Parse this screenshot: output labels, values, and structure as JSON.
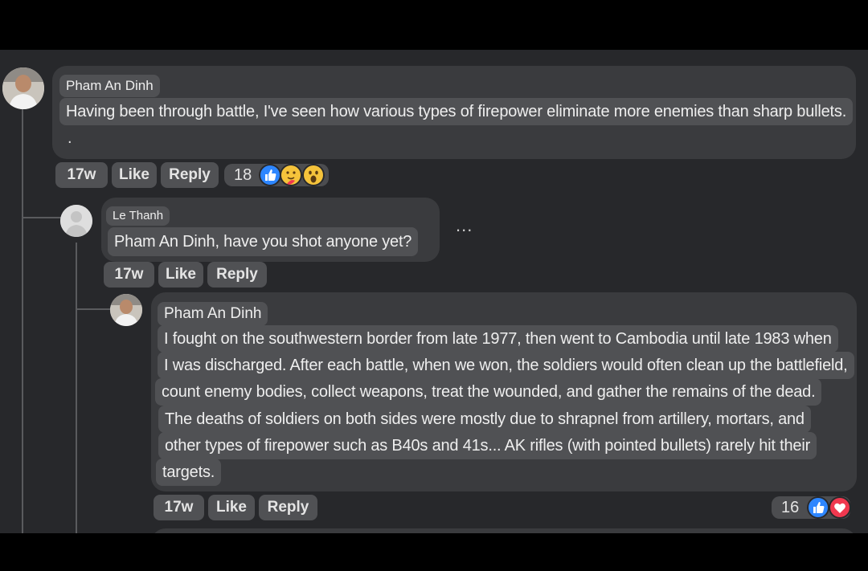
{
  "comments": [
    {
      "author": "Pham An Dinh",
      "lines": [
        "Having been through battle, I've seen how various types of firepower eliminate more enemies than sharp bullets.",
        "."
      ],
      "time": "17w",
      "like": "Like",
      "reply": "Reply",
      "reactions": "18",
      "reaction_icons": [
        "like-icon",
        "care-icon",
        "wow-icon"
      ]
    },
    {
      "author": "Le Thanh",
      "lines": [
        "Pham An Dinh, have you shot anyone yet?"
      ],
      "time": "17w",
      "like": "Like",
      "reply": "Reply",
      "more": "..."
    },
    {
      "author": "Pham An Dinh",
      "lines": [
        "I fought on the southwestern border from late 1977, then went to Cambodia until late 1983 when",
        "I was discharged. After each battle, when we won, the soldiers would often clean up the battlefield,",
        "count enemy bodies, collect weapons, treat the wounded, and gather the remains of the dead.",
        "The deaths of soldiers on both sides were mostly due to shrapnel from artillery, mortars, and",
        "other types of firepower such as B40s and 41s... AK rifles (with pointed bullets) rarely hit their",
        "targets."
      ],
      "time": "17w",
      "like": "Like",
      "reply": "Reply",
      "reactions": "16",
      "reaction_icons": [
        "like-icon",
        "love-icon"
      ]
    }
  ],
  "colors": {
    "background": "#27282b",
    "bubble": "#3a3b3e",
    "highlight": "#505154",
    "like_blue": "#2d86ff",
    "love_red": "#f0384f",
    "emoji_yellow": "#f5c33b"
  }
}
